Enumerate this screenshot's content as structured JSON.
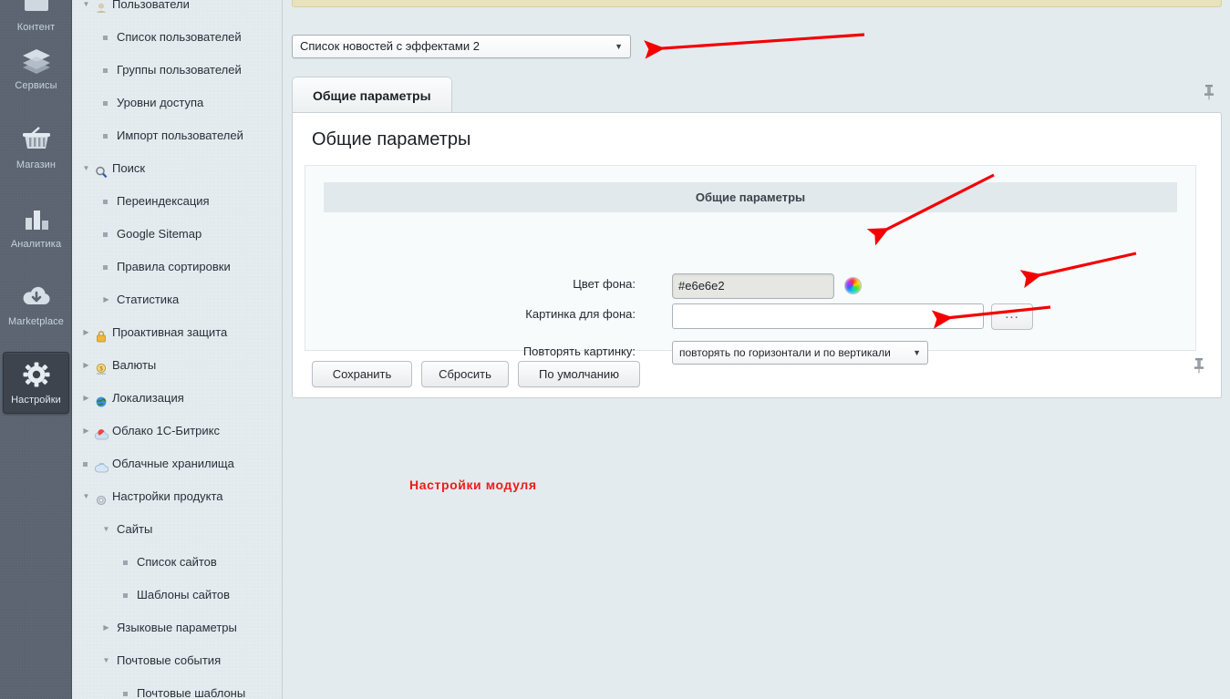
{
  "rail": {
    "items": [
      {
        "label": "Контент",
        "icon": "content-icon",
        "active": false
      },
      {
        "label": "Сервисы",
        "icon": "layers-icon",
        "active": false
      },
      {
        "label": "Магазин",
        "icon": "basket-icon",
        "active": false
      },
      {
        "label": "Аналитика",
        "icon": "bar-chart-icon",
        "active": false
      },
      {
        "label": "Marketplace",
        "icon": "cloud-down-icon",
        "active": false
      },
      {
        "label": "Настройки",
        "icon": "gear-icon",
        "active": true
      }
    ]
  },
  "tree": {
    "items": [
      {
        "label": "Пользователи",
        "indent": 0,
        "marker": "expanded",
        "icon": "users-icon"
      },
      {
        "label": "Список пользователей",
        "indent": 1,
        "marker": "bullet",
        "icon": ""
      },
      {
        "label": "Группы пользователей",
        "indent": 1,
        "marker": "bullet",
        "icon": ""
      },
      {
        "label": "Уровни доступа",
        "indent": 1,
        "marker": "bullet",
        "icon": ""
      },
      {
        "label": "Импорт пользователей",
        "indent": 1,
        "marker": "bullet",
        "icon": ""
      },
      {
        "label": "Поиск",
        "indent": 0,
        "marker": "expanded",
        "icon": "magnifier-icon"
      },
      {
        "label": "Переиндексация",
        "indent": 1,
        "marker": "bullet",
        "icon": ""
      },
      {
        "label": "Google Sitemap",
        "indent": 1,
        "marker": "bullet",
        "icon": ""
      },
      {
        "label": "Правила сортировки",
        "indent": 1,
        "marker": "bullet",
        "icon": ""
      },
      {
        "label": "Статистика",
        "indent": 1,
        "marker": "collapsed",
        "icon": ""
      },
      {
        "label": "Проактивная защита",
        "indent": 0,
        "marker": "collapsed",
        "icon": "lock-icon"
      },
      {
        "label": "Валюты",
        "indent": 0,
        "marker": "collapsed",
        "icon": "money-icon"
      },
      {
        "label": "Локализация",
        "indent": 0,
        "marker": "collapsed",
        "icon": "globe-icon"
      },
      {
        "label": "Облако 1С-Битрикс",
        "indent": 0,
        "marker": "collapsed",
        "icon": "cloud-bitrix-icon"
      },
      {
        "label": "Облачные хранилища",
        "indent": 0,
        "marker": "bullet",
        "icon": "cloud-storage-icon"
      },
      {
        "label": "Настройки продукта",
        "indent": 0,
        "marker": "expanded",
        "icon": "gear-small-icon"
      },
      {
        "label": "Сайты",
        "indent": 1,
        "marker": "expanded",
        "icon": ""
      },
      {
        "label": "Список сайтов",
        "indent": 2,
        "marker": "bullet",
        "icon": ""
      },
      {
        "label": "Шаблоны сайтов",
        "indent": 2,
        "marker": "bullet",
        "icon": ""
      },
      {
        "label": "Языковые параметры",
        "indent": 1,
        "marker": "collapsed",
        "icon": ""
      },
      {
        "label": "Почтовые события",
        "indent": 1,
        "marker": "expanded",
        "icon": ""
      },
      {
        "label": "Почтовые шаблоны",
        "indent": 2,
        "marker": "bullet",
        "icon": ""
      }
    ]
  },
  "main": {
    "module_select": {
      "value": "Список новостей с эффектами 2",
      "caret": "▼"
    },
    "tab": {
      "label": "Общие параметры"
    },
    "panel_title": "Общие параметры",
    "section_header": "Общие параметры",
    "fields": {
      "bg_color": {
        "label": "Цвет фона:",
        "value": "#e6e6e2",
        "placeholder": ""
      },
      "bg_image": {
        "label": "Картинка для фона:",
        "value": "",
        "placeholder": ""
      },
      "bg_repeat": {
        "label": "Повторять картинку:",
        "value": "повторять по горизонтали и по вертикали",
        "caret": "▼"
      }
    },
    "browse_button": "...",
    "buttons": {
      "save": "Сохранить",
      "reset": "Сбросить",
      "default": "По умолчанию"
    },
    "pin_icon": "pin-icon"
  },
  "annotation": {
    "text": "Настройки модуля",
    "color": "#ef1a1a",
    "arrow_count": 4
  },
  "colors": {
    "rail_bg": "#5b6470",
    "tree_bg": "#e2eaee",
    "page_bg": "#e4ebee",
    "notice_bar": "#e8e2bd",
    "panel_bg": "#ffffff",
    "section_head": "#e2e9ec",
    "annotation_red": "#ef1a1a"
  }
}
